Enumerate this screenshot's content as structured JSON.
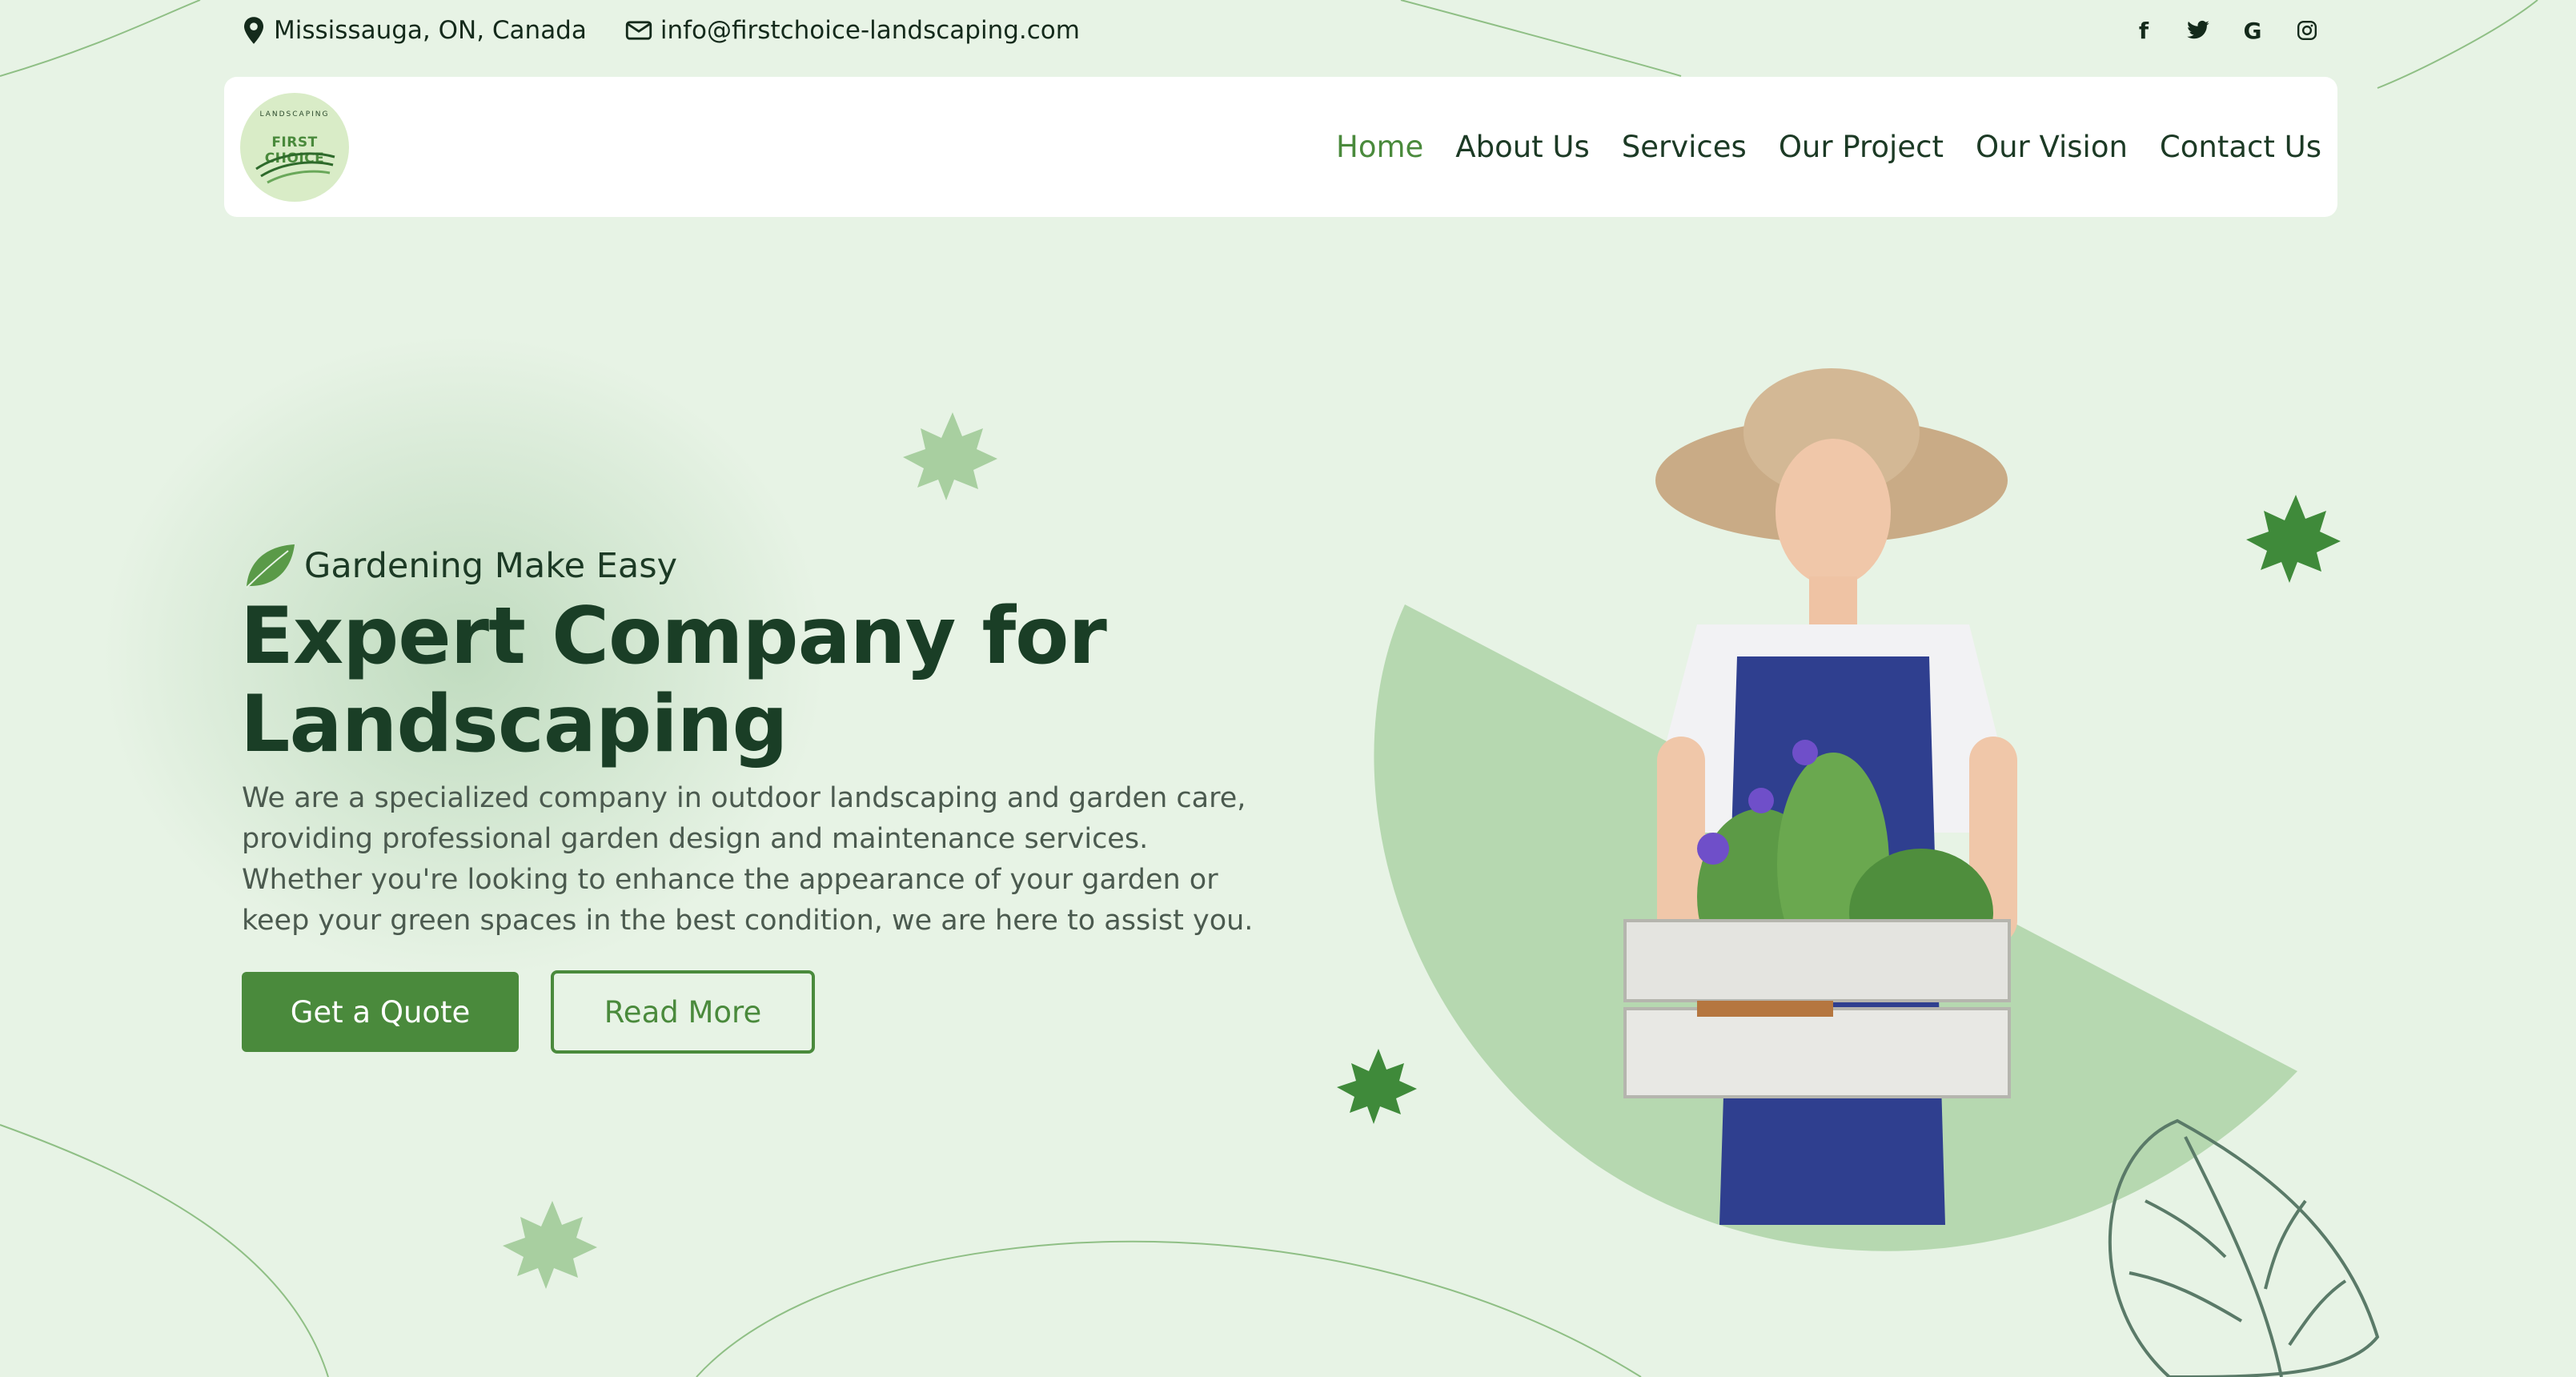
{
  "topbar": {
    "location": "Mississauga, ON, Canada",
    "email": "info@firstchoice-landscaping.com",
    "social": [
      "facebook-icon",
      "twitter-icon",
      "google-icon",
      "instagram-icon"
    ]
  },
  "logo": {
    "small_text": "LANDSCAPING",
    "name": "FIRST CHOICE"
  },
  "nav": {
    "items": [
      "Home",
      "About Us",
      "Services",
      "Our Project",
      "Our Vision",
      "Contact Us"
    ],
    "active": "Home"
  },
  "hero": {
    "tagline": "Gardening Make Easy",
    "title_line1": "Expert Company for",
    "title_line2": "Landscaping",
    "description": "We are a specialized company in outdoor landscaping and garden care, providing professional garden design and maintenance services. Whether you're looking to enhance the appearance of your garden or keep your green spaces in the best condition, we are here to assist you.",
    "primary_button": "Get a Quote",
    "secondary_button": "Read More"
  },
  "colors": {
    "background": "#e7f3e5",
    "accent": "#4a8a3c",
    "heading": "#1a3e26",
    "body_text": "#4b5a4f"
  }
}
